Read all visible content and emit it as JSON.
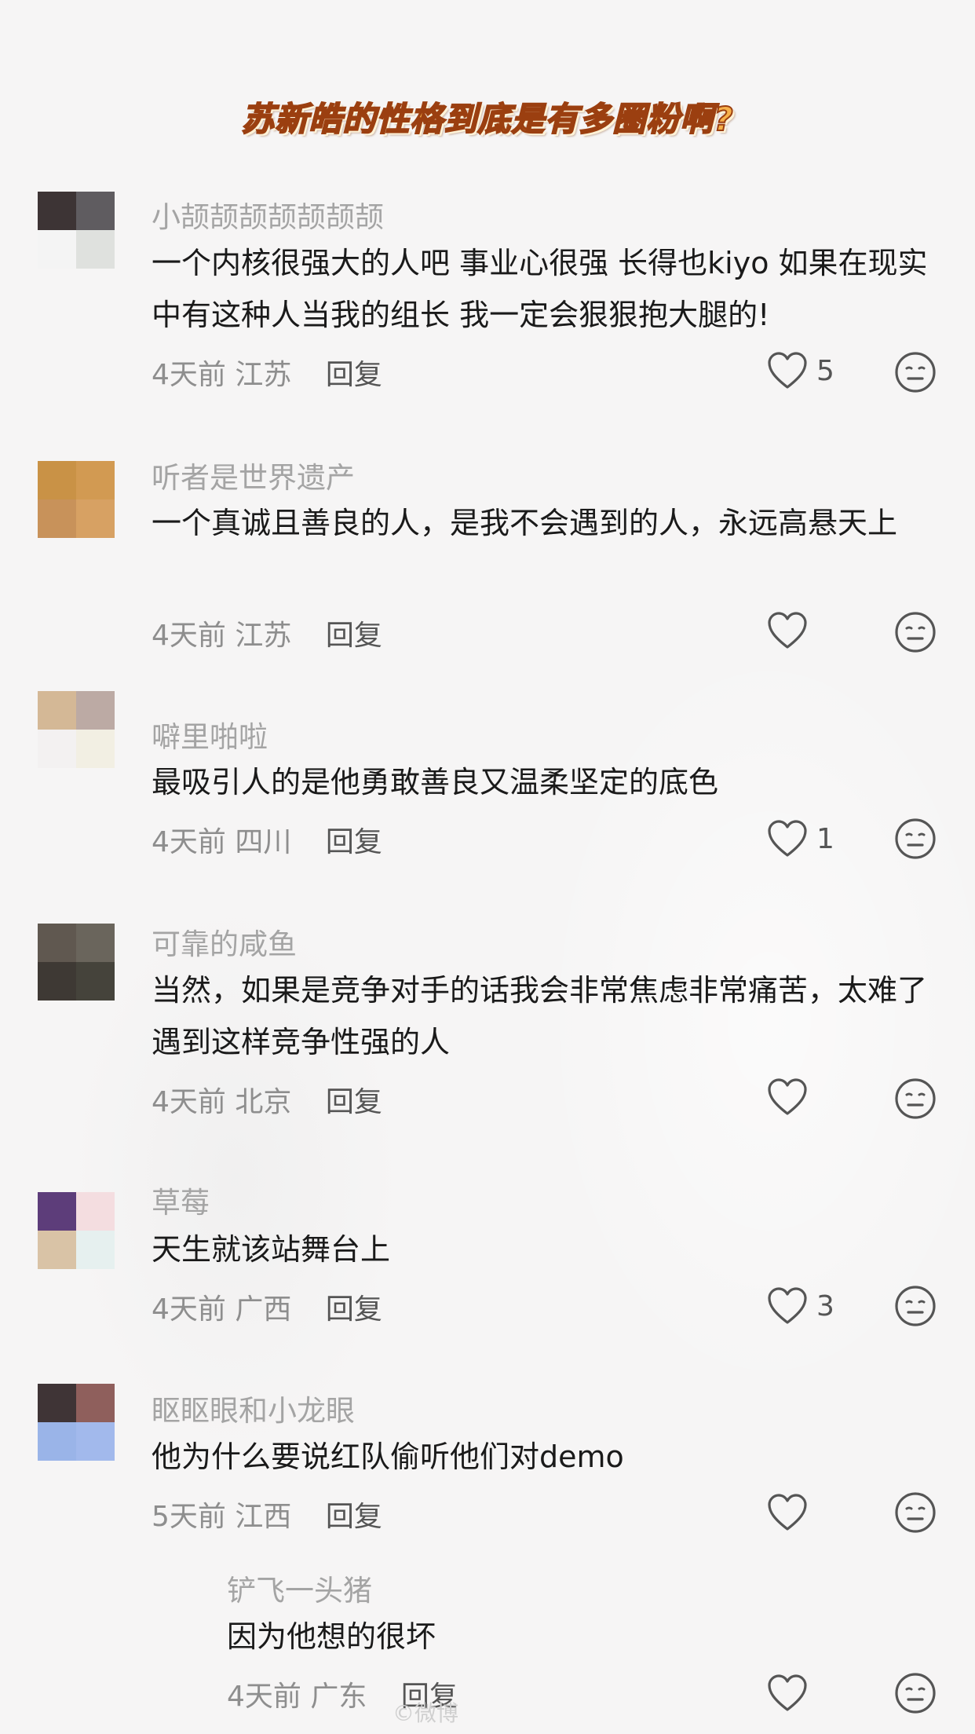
{
  "header": {
    "title": "苏新皓的性格到底是有多圈粉啊?"
  },
  "comments": [
    {
      "username": "小颉颉颉颉颉颉颉",
      "text": "一个内核很强大的人吧 事业心很强 长得也kiyo 如果在现实中有这种人当我的组长 我一定会狠狠抱大腿的!",
      "time": "4天前",
      "location": "江苏",
      "reply": "回复",
      "likes": "5",
      "avatar_colors": [
        "#3d3435",
        "#5f5c60",
        "#f4f4f4",
        "#dfe1de"
      ]
    },
    {
      "username": "听者是世界遗产",
      "text": "一个真诚且善良的人，是我不会遇到的人，永远高悬天上",
      "time": "4天前",
      "location": "江苏",
      "reply": "回复",
      "likes": "",
      "avatar_colors": [
        "#c99246",
        "#d29a52",
        "#c8925a",
        "#d7a163"
      ]
    },
    {
      "username": "噼里啪啦",
      "text": "最吸引人的是他勇敢善良又温柔坚定的底色",
      "time": "4天前",
      "location": "四川",
      "reply": "回复",
      "likes": "1",
      "avatar_colors": [
        "#d4b896",
        "#bcaaa4",
        "#f3f1f1",
        "#f2efe3"
      ]
    },
    {
      "username": "可靠的咸鱼",
      "text": "当然，如果是竞争对手的话我会非常焦虑非常痛苦，太难了遇到这样竞争性强的人",
      "time": "4天前",
      "location": "北京",
      "reply": "回复",
      "likes": "",
      "avatar_colors": [
        "#605850",
        "#6a655c",
        "#3e3934",
        "#45433b"
      ]
    },
    {
      "username": "草莓",
      "text": "天生就该站舞台上",
      "time": "4天前",
      "location": "广西",
      "reply": "回复",
      "likes": "3",
      "avatar_colors": [
        "#5d3d7a",
        "#f4dde0",
        "#d9c3a6",
        "#e6f0ef"
      ]
    },
    {
      "username": "眍眍眼和小龙眼",
      "text": "他为什么要说红队偷听他们对demo",
      "time": "5天前",
      "location": "江西",
      "reply": "回复",
      "likes": "",
      "avatar_colors": [
        "#3f3436",
        "#8f5f5c",
        "#9ab4e8",
        "#a2b9ec"
      ]
    }
  ],
  "replies": [
    {
      "username": "铲飞一头猪",
      "text": "因为他想的很坏",
      "time": "4天前",
      "location": "广东",
      "reply": "回复",
      "likes": ""
    }
  ],
  "watermark": "©微博"
}
